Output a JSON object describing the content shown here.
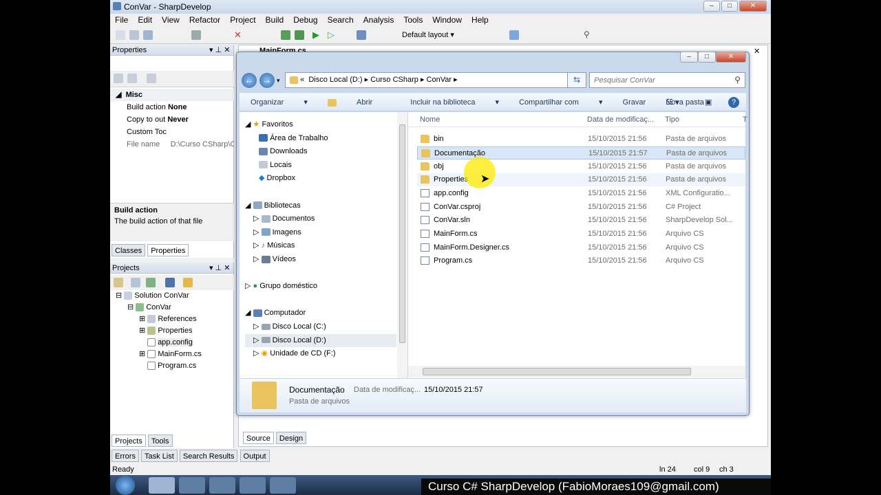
{
  "window": {
    "title": "ConVar - SharpDevelop"
  },
  "menu": [
    "File",
    "Edit",
    "View",
    "Refactor",
    "Project",
    "Build",
    "Debug",
    "Search",
    "Analysis",
    "Tools",
    "Window",
    "Help"
  ],
  "toolbar": {
    "layout": "Default layout"
  },
  "properties": {
    "title": "Properties",
    "category": "Misc",
    "rows": [
      {
        "name": "Build action",
        "value": "None"
      },
      {
        "name": "Copy to out",
        "value": "Never"
      },
      {
        "name": "Custom Toc",
        "value": ""
      },
      {
        "name": "File name",
        "value": "D:\\Curso CSharp\\C"
      }
    ],
    "help_title": "Build action",
    "help_text": "The build action of that file",
    "tabs": [
      "Classes",
      "Properties"
    ]
  },
  "projects": {
    "title": "Projects",
    "tree": [
      "Solution ConVar",
      "ConVar",
      "References",
      "Properties",
      "app.config",
      "MainForm.cs",
      "Program.cs"
    ],
    "tabs": [
      "Projects",
      "Tools"
    ]
  },
  "editor": {
    "tab": "MainForm.cs",
    "bottom_tabs": [
      "Source",
      "Design"
    ]
  },
  "bottom_tabs": [
    "Errors",
    "Task List",
    "Search Results",
    "Output"
  ],
  "status": {
    "left": "Ready",
    "ln": "ln 24",
    "col": "col 9",
    "ch": "ch 3"
  },
  "explorer": {
    "breadcrumb": [
      "«",
      "Disco Local (D:)",
      "Curso CSharp",
      "ConVar"
    ],
    "search_placeholder": "Pesquisar ConVar",
    "commands": [
      "Organizar",
      "Abrir",
      "Incluir na biblioteca",
      "Compartilhar com",
      "Gravar",
      "Nova pasta"
    ],
    "nav": {
      "favorites": {
        "label": "Favoritos",
        "items": [
          "Área de Trabalho",
          "Downloads",
          "Locais",
          "Dropbox"
        ]
      },
      "libraries": {
        "label": "Bibliotecas",
        "items": [
          "Documentos",
          "Imagens",
          "Músicas",
          "Vídeos"
        ]
      },
      "homegroup": "Grupo doméstico",
      "computer": {
        "label": "Computador",
        "items": [
          "Disco Local (C:)",
          "Disco Local (D:)",
          "Unidade de CD (F:)"
        ]
      }
    },
    "columns": [
      "Nome",
      "Data de modificaç...",
      "Tipo",
      "T"
    ],
    "files": [
      {
        "name": "bin",
        "date": "15/10/2015 21:56",
        "type": "Pasta de arquivos",
        "kind": "folder"
      },
      {
        "name": "Documentação",
        "date": "15/10/2015 21:57",
        "type": "Pasta de arquivos",
        "kind": "folder"
      },
      {
        "name": "obj",
        "date": "15/10/2015 21:56",
        "type": "Pasta de arquivos",
        "kind": "folder"
      },
      {
        "name": "Properties",
        "date": "15/10/2015 21:56",
        "type": "Pasta de arquivos",
        "kind": "folder"
      },
      {
        "name": "app.config",
        "date": "15/10/2015 21:56",
        "type": "XML Configuratio...",
        "kind": "file"
      },
      {
        "name": "ConVar.csproj",
        "date": "15/10/2015 21:56",
        "type": "C# Project",
        "kind": "file"
      },
      {
        "name": "ConVar.sln",
        "date": "15/10/2015 21:56",
        "type": "SharpDevelop Sol...",
        "kind": "file"
      },
      {
        "name": "MainForm.cs",
        "date": "15/10/2015 21:56",
        "type": "Arquivo CS",
        "kind": "file"
      },
      {
        "name": "MainForm.Designer.cs",
        "date": "15/10/2015 21:56",
        "type": "Arquivo CS",
        "kind": "file"
      },
      {
        "name": "Program.cs",
        "date": "15/10/2015 21:56",
        "type": "Arquivo CS",
        "kind": "file"
      }
    ],
    "details": {
      "name": "Documentação",
      "date_label": "Data de modificaç...",
      "date": "15/10/2015 21:57",
      "type": "Pasta de arquivos"
    }
  },
  "banner": "Curso C# SharpDevelop (FabioMoraes109@gmail.com)"
}
